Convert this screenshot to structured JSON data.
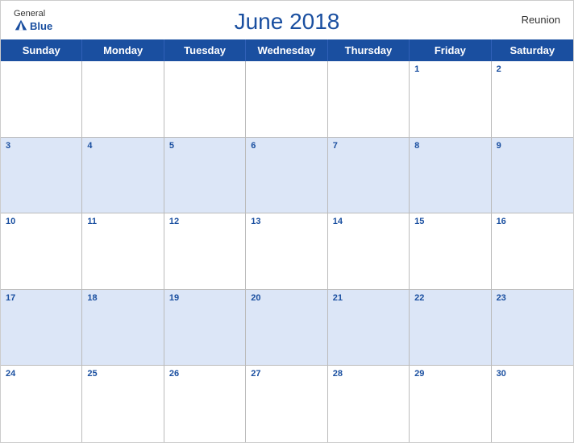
{
  "header": {
    "logo": {
      "general": "General",
      "blue": "Blue"
    },
    "title": "June 2018",
    "region": "Reunion"
  },
  "days": [
    "Sunday",
    "Monday",
    "Tuesday",
    "Wednesday",
    "Thursday",
    "Friday",
    "Saturday"
  ],
  "weeks": [
    [
      null,
      null,
      null,
      null,
      null,
      1,
      2
    ],
    [
      3,
      4,
      5,
      6,
      7,
      8,
      9
    ],
    [
      10,
      11,
      12,
      13,
      14,
      15,
      16
    ],
    [
      17,
      18,
      19,
      20,
      21,
      22,
      23
    ],
    [
      24,
      25,
      26,
      27,
      28,
      29,
      30
    ]
  ],
  "colors": {
    "primary": "#1a4fa0",
    "row_alt": "#dce6f7",
    "row_normal": "#ffffff"
  }
}
